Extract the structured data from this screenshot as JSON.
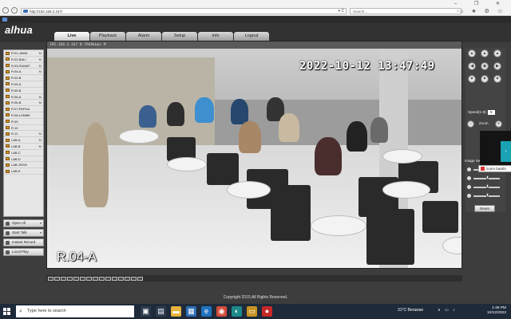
{
  "browser": {
    "url": "http://192.168.2.167/",
    "search_placeholder": "Search...",
    "tab_title": "PREVIEW",
    "win_controls": "– ❐ ✕",
    "addr_controls": "▾ C",
    "tool_icons": "⌂ ★ ⚙ ☺"
  },
  "app": {
    "logo": "alhua",
    "nav_tabs": [
      "Live",
      "Playback",
      "Alarm",
      "Setup",
      "Info",
      "Logout"
    ],
    "active_tab": "Live",
    "channels": [
      {
        "name": "R.01-JAWA",
        "mark": "M"
      },
      {
        "name": "R.02-BALI",
        "mark": "M"
      },
      {
        "name": "R.03-SUMAT",
        "mark": "M"
      },
      {
        "name": "R.04-A",
        "mark": "M"
      },
      {
        "name": "R.04-B",
        "mark": ""
      },
      {
        "name": "R.05-A",
        "mark": ""
      },
      {
        "name": "R.05-B",
        "mark": ""
      },
      {
        "name": "R.06-A",
        "mark": "M"
      },
      {
        "name": "R.06-B",
        "mark": "M"
      },
      {
        "name": "R.07-PAPUA",
        "mark": ""
      },
      {
        "name": "R.08-LOMBK",
        "mark": ""
      },
      {
        "name": "R.09",
        "mark": ""
      },
      {
        "name": "R.10",
        "mark": ""
      },
      {
        "name": "R.11",
        "mark": "M"
      },
      {
        "name": "LAB-A",
        "mark": "M"
      },
      {
        "name": "LAB-B",
        "mark": "M"
      },
      {
        "name": "LAB-C",
        "mark": ""
      },
      {
        "name": "LAB-D",
        "mark": ""
      },
      {
        "name": "LAB-JRGN",
        "mark": ""
      },
      {
        "name": "LAB-E",
        "mark": ""
      }
    ],
    "side_buttons": [
      {
        "label": "Open All",
        "arrow": "▾"
      },
      {
        "label": "Start Talk",
        "arrow": "▾"
      },
      {
        "label": "Instant Record",
        "arrow": ""
      },
      {
        "label": "Local Play",
        "arrow": ""
      }
    ],
    "video": {
      "info": "192.168.2.167 N 7968kbps M",
      "timestamp": "2022-10-12 13:47:49",
      "camera_label": "R.04-A"
    },
    "ptz": {
      "buttons": [
        "▲",
        "▲",
        "▲",
        "◀",
        "◉",
        "▶",
        "▼",
        "▼",
        "▼"
      ],
      "speed_label": "Speed(1-8):",
      "speed_value": "5",
      "zoom_label": "Zoom",
      "zoom_minus": "−",
      "zoom_plus": "+",
      "image_settings_label": "Image Se",
      "reset_label": "Reset"
    },
    "zoom_popup": "zoom baa04",
    "copyright": "Copyright 2015,All Rights Reserved."
  },
  "taskbar": {
    "search_placeholder": "Type here to search",
    "weather": "31°C  Berawan",
    "time": "1:48 PM",
    "date": "10/12/2022",
    "tray_icons": "∧ ▭ ♪"
  }
}
